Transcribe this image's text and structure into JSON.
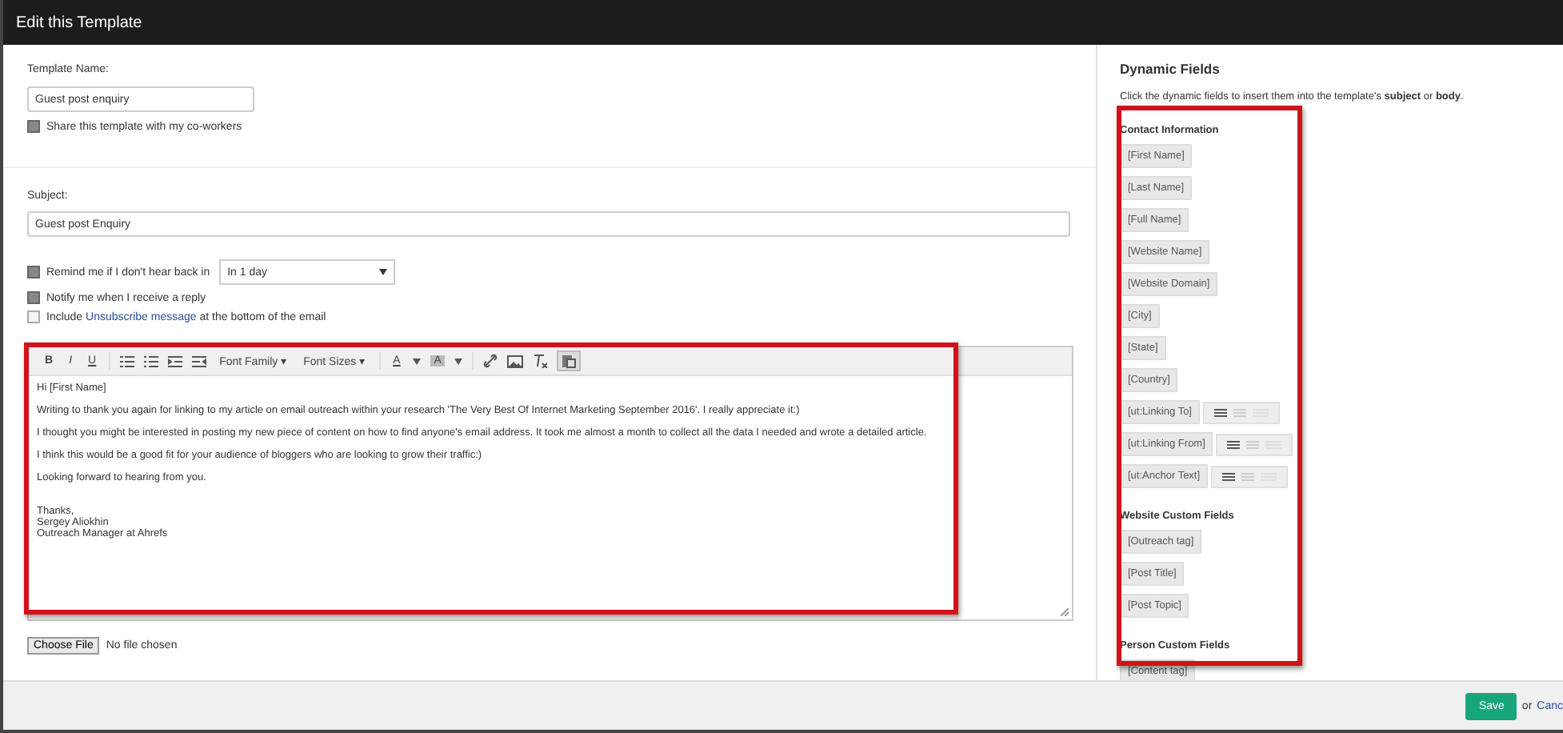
{
  "window": {
    "title": "Edit this Template"
  },
  "template_name": {
    "label": "Template Name:",
    "value": "Guest post enquiry"
  },
  "share": {
    "label": "Share this template with my co-workers",
    "checked": true
  },
  "subject": {
    "label": "Subject:",
    "value": "Guest post Enquiry"
  },
  "remind": {
    "label": "Remind me if I don't hear back in",
    "checked": true,
    "select_value": "In 1 day"
  },
  "notify": {
    "label": "Notify me when I receive a reply",
    "checked": true
  },
  "unsubscribe": {
    "before": "Include",
    "link": "Unsubscribe message",
    "after": "at the bottom of the email",
    "checked": false
  },
  "editor": {
    "toolbar": {
      "bold": "B",
      "italic": "I",
      "underline": "U",
      "font_family": "Font Family ▾",
      "font_sizes": "Font Sizes ▾",
      "text_color": "A",
      "background_color": "A"
    },
    "paragraphs": [
      "Hi [First Name]",
      "Writing to thank you again for linking to my article on email outreach within your research 'The Very Best Of Internet Marketing September 2016'. I really appreciate it:)",
      "I thought you might be interested in posting my new piece of content on how to find anyone's email address. It took me almost a month to collect all the data I needed and wrote a detailed article.",
      "I think this would be a good fit for your audience of bloggers who are looking to grow their traffic:)",
      "Looking forward to hearing from you."
    ],
    "signature": [
      "Thanks,",
      "Sergey Aliokhin",
      "Outreach Manager at Ahrefs"
    ]
  },
  "file": {
    "button": "Choose File",
    "status": "No file chosen"
  },
  "dynamic_fields": {
    "title": "Dynamic Fields",
    "description": "Click the dynamic fields to insert them into the template's **subject** or **body**.",
    "groups": [
      {
        "title": "Contact Information",
        "fields": [
          {
            "label": "[First Name]",
            "kind": "plain"
          },
          {
            "label": "[Last Name]",
            "kind": "plain"
          },
          {
            "label": "[Full Name]",
            "kind": "plain"
          },
          {
            "label": "[Website Name]",
            "kind": "plain"
          },
          {
            "label": "[Website Domain]",
            "kind": "plain"
          },
          {
            "label": "[City]",
            "kind": "plain"
          },
          {
            "label": "[State]",
            "kind": "plain"
          },
          {
            "label": "[Country]",
            "kind": "plain"
          },
          {
            "label": "[ut:Linking To]",
            "kind": "list"
          },
          {
            "label": "[ut:Linking From]",
            "kind": "list"
          },
          {
            "label": "[ut:Anchor Text]",
            "kind": "list"
          }
        ]
      },
      {
        "title": "Website Custom Fields",
        "fields": [
          {
            "label": "[Outreach tag]",
            "kind": "plain"
          },
          {
            "label": "[Post Title]",
            "kind": "plain"
          },
          {
            "label": "[Post Topic]",
            "kind": "plain"
          }
        ]
      },
      {
        "title": "Person Custom Fields",
        "fields": [
          {
            "label": "[Content tag]",
            "kind": "plain"
          }
        ]
      }
    ]
  },
  "footer": {
    "save": "Save",
    "or": "or",
    "cancel": "Canc"
  }
}
